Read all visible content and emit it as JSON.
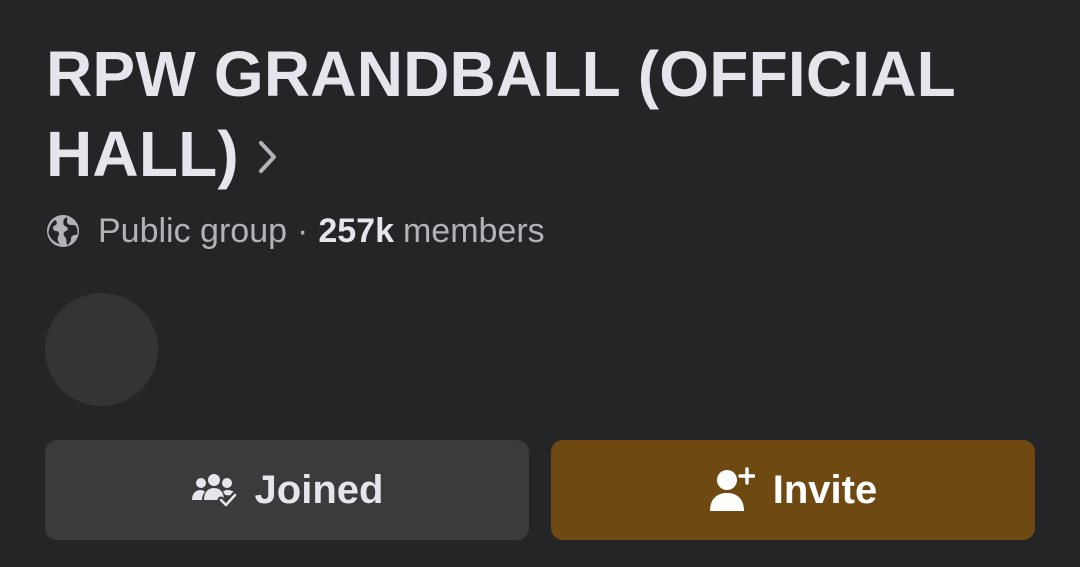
{
  "group": {
    "title": "RPW GRANDBALL (OFFICIAL HALL)",
    "privacy": "Public group",
    "separator": "·",
    "member_count": "257k",
    "members_label": "members"
  },
  "actions": {
    "joined_label": "Joined",
    "invite_label": "Invite"
  },
  "icons": {
    "title_chevron": "chevron-right-icon",
    "privacy": "globe-icon",
    "joined": "group-check-icon",
    "invite": "add-person-icon"
  },
  "colors": {
    "background": "#242527",
    "text_primary": "#e4e6eb",
    "text_secondary": "#b0b3b8",
    "joined_button": "#3a3b3c",
    "invite_button": "#6e4a12"
  }
}
